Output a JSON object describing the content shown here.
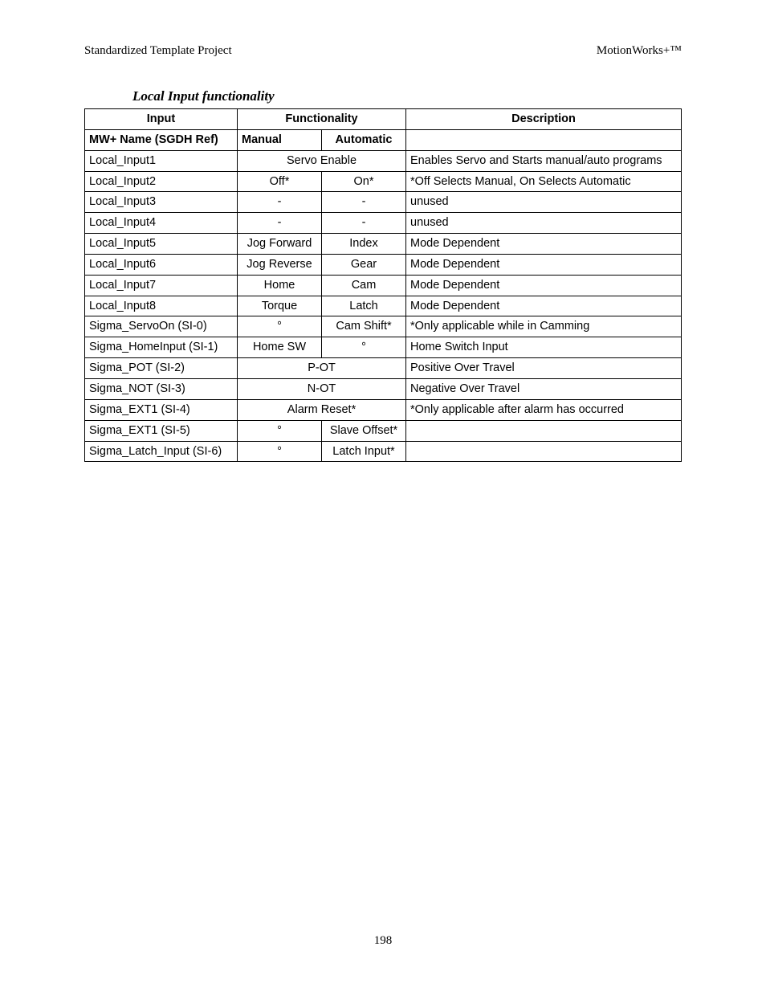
{
  "header": {
    "left": "Standardized Template Project",
    "right": "MotionWorks+™"
  },
  "section_title": "Local Input functionality",
  "columns": {
    "input": "Input",
    "functionality": "Functionality",
    "description": "Description",
    "mw_name": "MW+ Name (SGDH Ref)",
    "manual": "Manual",
    "automatic": "Automatic"
  },
  "rows": [
    {
      "name": "Local_Input1",
      "merged": "Servo Enable",
      "desc": "Enables Servo and Starts manual/auto programs"
    },
    {
      "name": "Local_Input2",
      "manual": "Off*",
      "auto": "On*",
      "desc": "*Off Selects Manual, On Selects Automatic"
    },
    {
      "name": "Local_Input3",
      "manual": "-",
      "auto": "-",
      "desc": "unused"
    },
    {
      "name": "Local_Input4",
      "manual": "-",
      "auto": "-",
      "desc": "unused"
    },
    {
      "name": "Local_Input5",
      "manual": "Jog Forward",
      "auto": "Index",
      "desc": "Mode Dependent"
    },
    {
      "name": "Local_Input6",
      "manual": "Jog Reverse",
      "auto": "Gear",
      "desc": "Mode Dependent"
    },
    {
      "name": "Local_Input7",
      "manual": "Home",
      "auto": "Cam",
      "desc": "Mode Dependent"
    },
    {
      "name": "Local_Input8",
      "manual": "Torque",
      "auto": "Latch",
      "desc": "Mode Dependent"
    },
    {
      "name": "Sigma_ServoOn (SI-0)",
      "manual": "°",
      "auto": "Cam Shift*",
      "desc": "*Only applicable while in Camming"
    },
    {
      "name": "Sigma_HomeInput (SI-1)",
      "manual": "Home SW",
      "auto": "°",
      "desc": "Home Switch Input"
    },
    {
      "name": "Sigma_POT (SI-2)",
      "merged": "P-OT",
      "desc": "Positive Over Travel"
    },
    {
      "name": "Sigma_NOT (SI-3)",
      "merged": "N-OT",
      "desc": "Negative Over Travel"
    },
    {
      "name": "Sigma_EXT1 (SI-4)",
      "merged": "Alarm Reset*",
      "desc": "*Only applicable after alarm has occurred"
    },
    {
      "name": "Sigma_EXT1 (SI-5)",
      "manual": "°",
      "auto": "Slave Offset*",
      "desc": ""
    },
    {
      "name": "Sigma_Latch_Input (SI-6)",
      "manual": "°",
      "auto": "Latch Input*",
      "desc": ""
    }
  ],
  "page_number": "198"
}
